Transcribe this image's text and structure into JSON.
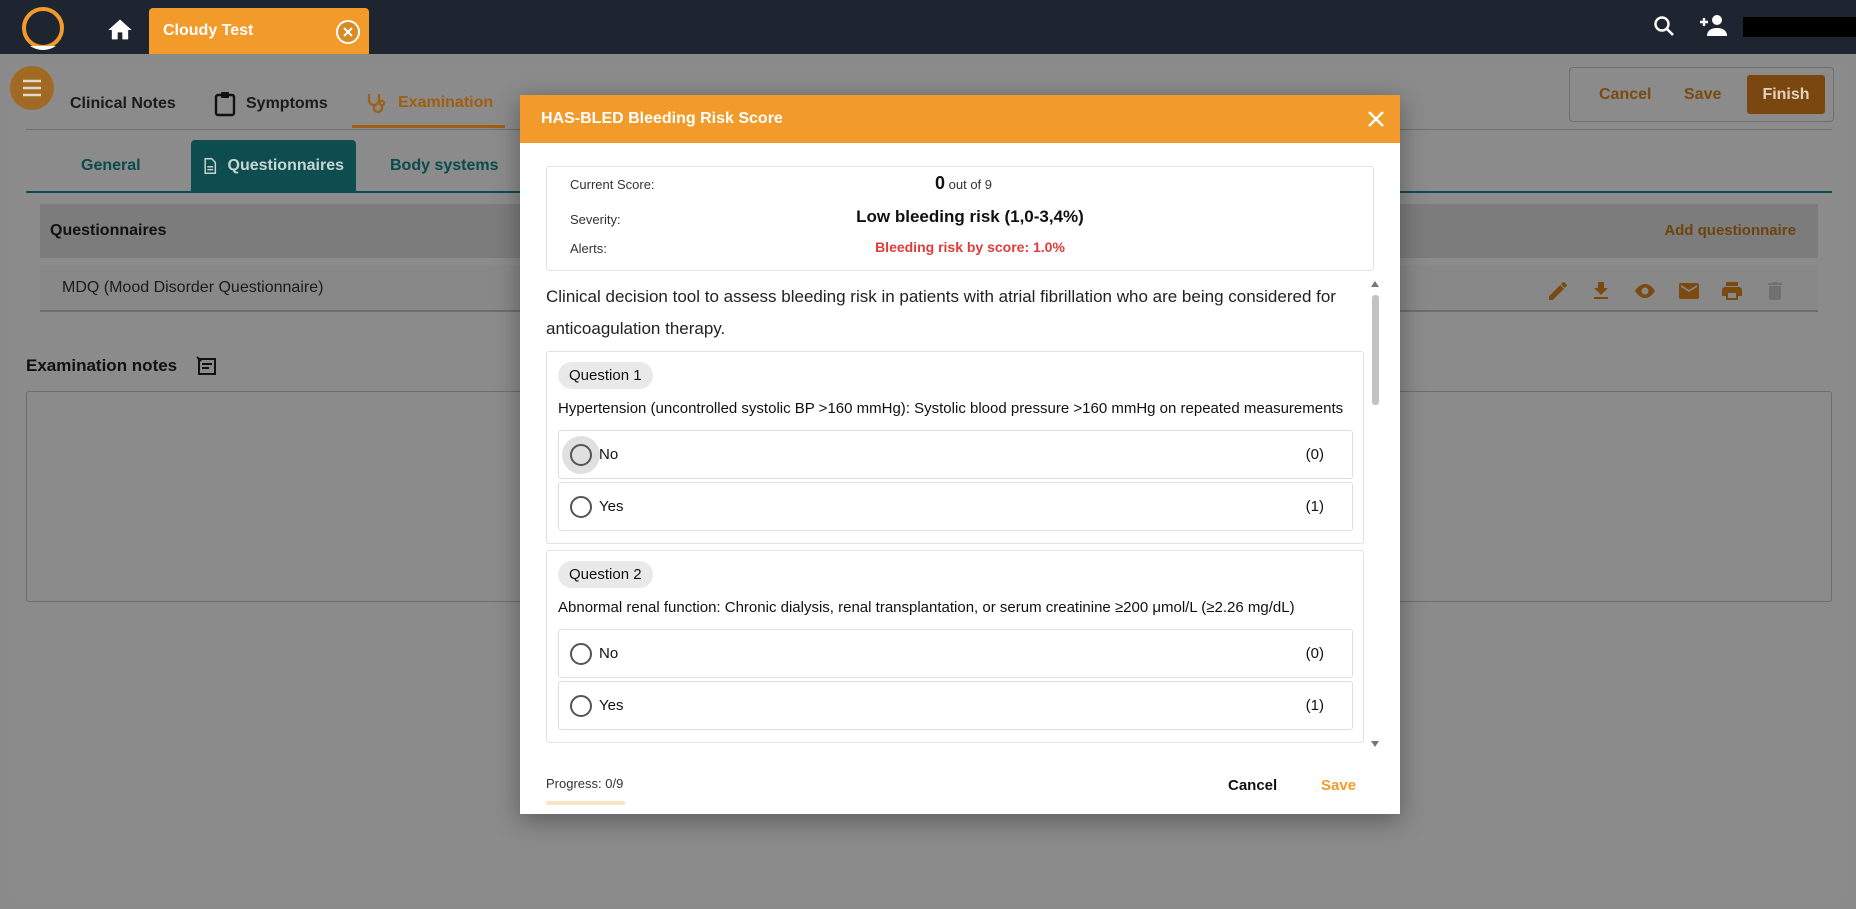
{
  "topbar": {
    "patient_tab_label": "Cloudy Test",
    "icons": [
      "app-logo",
      "home-icon",
      "close-icon",
      "search-icon",
      "add-user-icon"
    ]
  },
  "main_tabs": [
    {
      "label": "Clinical Notes",
      "icon": "chat-icon"
    },
    {
      "label": "Symptoms",
      "icon": "clipboard-icon"
    },
    {
      "label": "Examination",
      "icon": "stethoscope-icon"
    }
  ],
  "actions": {
    "cancel": "Cancel",
    "save": "Save",
    "finish": "Finish"
  },
  "sub_tabs": [
    {
      "label": "General"
    },
    {
      "label": "Questionnaires",
      "icon": "document-icon"
    },
    {
      "label": "Body systems"
    }
  ],
  "questionnaires": {
    "header": "Questionnaires",
    "add_label": "Add questionnaire",
    "rows": [
      {
        "title": "MDQ (Mood Disorder Questionnaire)"
      }
    ]
  },
  "examination": {
    "notes_title": "Examination notes"
  },
  "modal": {
    "title": "HAS-BLED Bleeding Risk Score",
    "score_label": "Current Score:",
    "score_value": "0",
    "score_suffix": "out of 9",
    "severity_label": "Severity:",
    "severity_value": "Low bleeding risk (1,0-3,4%)",
    "alerts_label": "Alerts:",
    "alerts_value": "Bleeding risk by score: 1.0%",
    "description": "Clinical decision tool to assess bleeding risk in patients with atrial fibrillation who are being considered for anticoagulation therapy.",
    "questions": [
      {
        "chip": "Question 1",
        "text": "Hypertension (uncontrolled systolic BP >160 mmHg): Systolic blood pressure >160 mmHg on repeated measurements",
        "options": [
          {
            "label": "No",
            "points": "(0)"
          },
          {
            "label": "Yes",
            "points": "(1)"
          }
        ]
      },
      {
        "chip": "Question 2",
        "text": "Abnormal renal function: Chronic dialysis, renal transplantation, or serum creatinine ≥200 μmol/L (≥2.26 mg/dL)",
        "options": [
          {
            "label": "No",
            "points": "(0)"
          },
          {
            "label": "Yes",
            "points": "(1)"
          }
        ]
      }
    ],
    "progress_label": "Progress: 0/9",
    "progress_fraction": 0,
    "cancel_label": "Cancel",
    "save_label": "Save"
  },
  "colors": {
    "accent": "#f39b2a",
    "topbar": "#1e2531",
    "teal": "#0d4d50",
    "alert": "#e23b3b"
  }
}
